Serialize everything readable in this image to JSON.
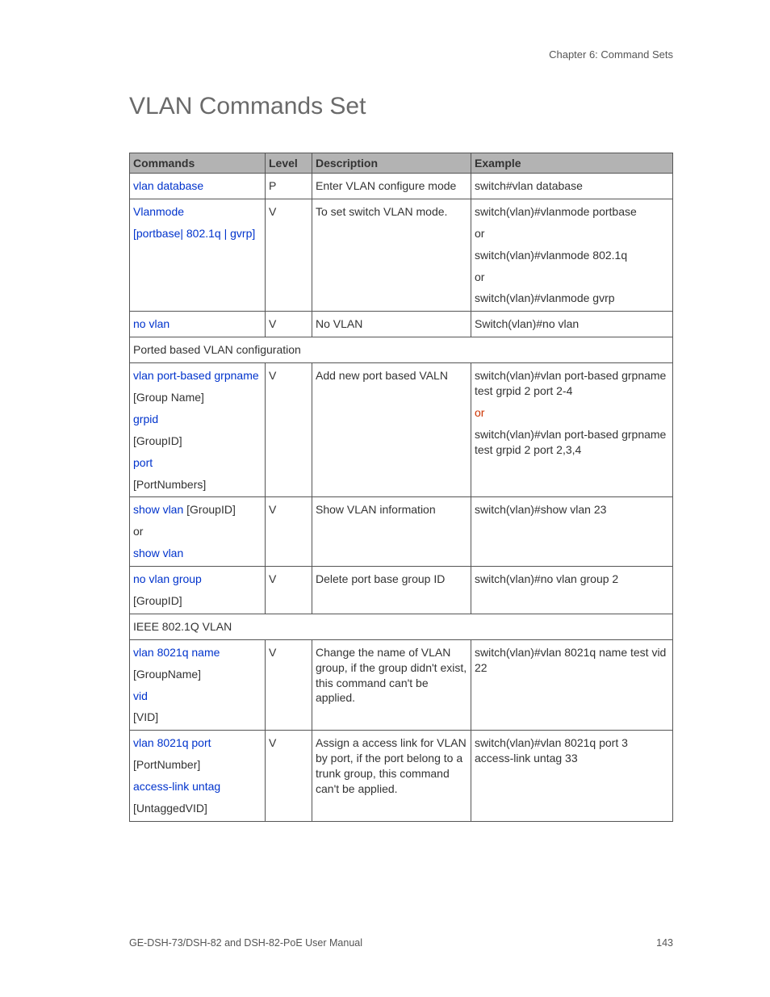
{
  "chapter": "Chapter 6: Command Sets",
  "title": "VLAN Commands Set",
  "headers": {
    "c1": "Commands",
    "c2": "Level",
    "c3": "Description",
    "c4": "Example"
  },
  "rows": [
    {
      "cmd": [
        {
          "t": "vlan database",
          "c": "blue"
        }
      ],
      "level": "P",
      "desc": "Enter VLAN configure mode",
      "ex": [
        {
          "t": "switch#vlan database",
          "c": "blk"
        }
      ]
    },
    {
      "cmd": [
        {
          "t": "Vlanmode",
          "c": "blue"
        },
        {
          "t": "[portbase| 802.1q |  gvrp]",
          "c": "blue"
        }
      ],
      "level": "V",
      "desc": "To set switch VLAN mode.",
      "ex": [
        {
          "t": "switch(vlan)#vlanmode portbase",
          "c": "blk"
        },
        {
          "t": "or",
          "c": "blk"
        },
        {
          "t": "switch(vlan)#vlanmode 802.1q",
          "c": "blk"
        },
        {
          "t": "or",
          "c": "blk"
        },
        {
          "t": "switch(vlan)#vlanmode gvrp",
          "c": "blk"
        }
      ]
    },
    {
      "cmd": [
        {
          "t": "no vlan",
          "c": "blue"
        }
      ],
      "level": "V",
      "desc": "No VLAN",
      "ex": [
        {
          "t": "Switch(vlan)#no vlan",
          "c": "blk"
        }
      ]
    },
    {
      "section": "Ported based VLAN configuration"
    },
    {
      "cmd": [
        {
          "t": "vlan port-based grpname",
          "c": "blue"
        },
        {
          "t": "[Group Name]",
          "c": "blk"
        },
        {
          "t": "grpid",
          "c": "blue"
        },
        {
          "t": "[GroupID]",
          "c": "blk"
        },
        {
          "t": "port",
          "c": "blue"
        },
        {
          "t": "[PortNumbers]",
          "c": "blk"
        }
      ],
      "level": "V",
      "desc": "Add new port based VALN",
      "ex": [
        {
          "t": "switch(vlan)#vlan port-based grpname test grpid 2 port 2-4",
          "c": "blk"
        },
        {
          "t": "or",
          "c": "red"
        },
        {
          "t": "switch(vlan)#vlan port-based grpname test grpid 2 port 2,3,4",
          "c": "blk"
        }
      ]
    },
    {
      "cmd_mixed": true,
      "cmd": [
        {
          "parts": [
            {
              "t": "show vlan ",
              "c": "blue"
            },
            {
              "t": "[GroupID]",
              "c": "blk"
            }
          ]
        },
        {
          "t": "or",
          "c": "blk"
        },
        {
          "t": "show vlan",
          "c": "blue"
        }
      ],
      "level": "V",
      "desc": "Show VLAN information",
      "ex": [
        {
          "t": "switch(vlan)#show vlan 23",
          "c": "blk"
        }
      ]
    },
    {
      "cmd": [
        {
          "t": "no vlan group",
          "c": "blue"
        },
        {
          "t": "[GroupID]",
          "c": "blk"
        }
      ],
      "level": "V",
      "desc": "Delete port base group ID",
      "ex": [
        {
          "t": "switch(vlan)#no vlan group 2",
          "c": "blk"
        }
      ]
    },
    {
      "section": "IEEE 802.1Q VLAN"
    },
    {
      "cmd": [
        {
          "t": "vlan 8021q name",
          "c": "blue"
        },
        {
          "t": "[GroupName]",
          "c": "blk"
        },
        {
          "t": "vid",
          "c": "blue"
        },
        {
          "t": "[VID]",
          "c": "blk"
        }
      ],
      "level": "V",
      "desc": "Change the name of VLAN group, if the group didn't exist, this command can't be applied.",
      "ex": [
        {
          "t": "switch(vlan)#vlan 8021q name test vid 22",
          "c": "blk"
        }
      ]
    },
    {
      "cmd": [
        {
          "t": "vlan 8021q port",
          "c": "blue"
        },
        {
          "t": "[PortNumber]",
          "c": "blk"
        },
        {
          "t": "access-link untag",
          "c": "blue"
        },
        {
          "t": "[UntaggedVID]",
          "c": "blk"
        }
      ],
      "level": "V",
      "desc": "Assign a access link for VLAN by port, if the port belong to a trunk group, this command can't be applied.",
      "ex": [
        {
          "t": "switch(vlan)#vlan 8021q port 3 access-link untag 33",
          "c": "blk"
        }
      ]
    }
  ],
  "footer_left": "GE-DSH-73/DSH-82 and DSH-82-PoE User Manual",
  "footer_right": "143"
}
